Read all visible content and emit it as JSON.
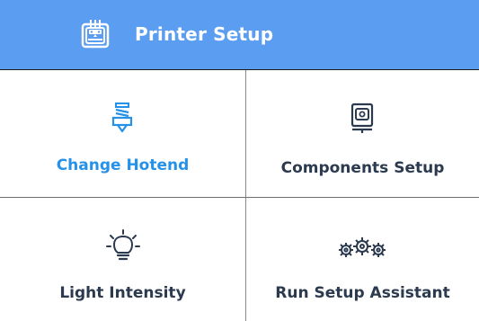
{
  "header": {
    "title": "Printer Setup",
    "icon": "printer-icon",
    "background": "#5b9ef1"
  },
  "tiles": [
    {
      "label": "Change Hotend",
      "icon": "hotend-icon",
      "color": "#2591e8",
      "selected": true
    },
    {
      "label": "Components Setup",
      "icon": "component-icon",
      "color": "#2b3a4f"
    },
    {
      "label": "Light Intensity",
      "icon": "lightbulb-icon",
      "color": "#2b3a4f"
    },
    {
      "label": "Run Setup Assistant",
      "icon": "gears-icon",
      "color": "#2b3a4f"
    }
  ]
}
